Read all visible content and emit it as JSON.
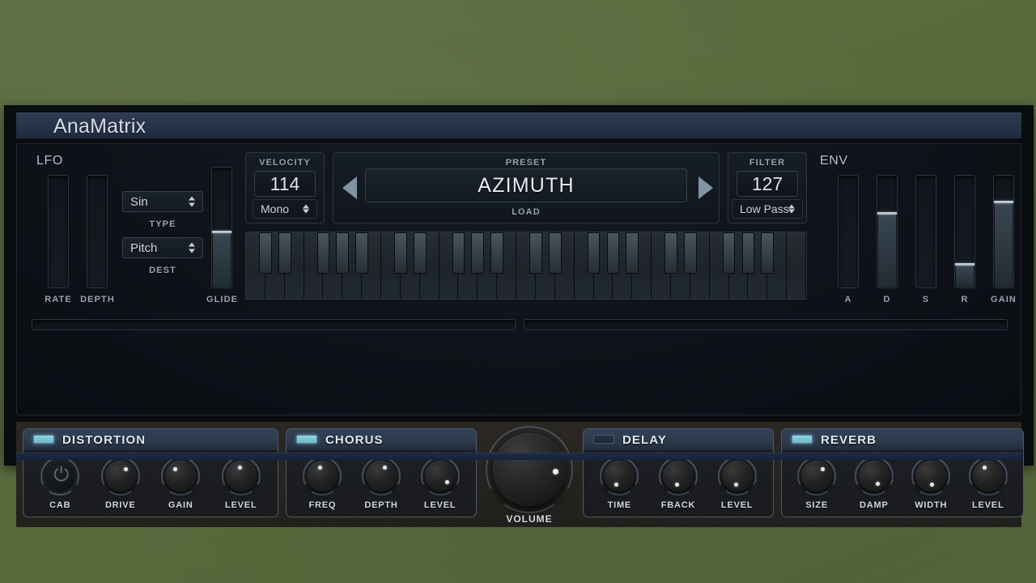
{
  "app": {
    "title": "AnaMatrix"
  },
  "lfo": {
    "section_label": "LFO",
    "rate_label": "RATE",
    "depth_label": "DEPTH",
    "rate_value": 0,
    "depth_value": 0,
    "type_label": "TYPE",
    "type_value": "Sin",
    "dest_label": "DEST",
    "dest_value": "Pitch"
  },
  "glide": {
    "label": "GLIDE",
    "value": 46
  },
  "velocity": {
    "label": "VELOCITY",
    "value": "114",
    "mode": "Mono"
  },
  "preset": {
    "label": "PRESET",
    "name": "AZIMUTH",
    "load_label": "LOAD",
    "prev_icon": "triangle-left-icon",
    "next_icon": "triangle-right-icon"
  },
  "filter": {
    "label": "FILTER",
    "value": "127",
    "type": "Low Pass"
  },
  "env": {
    "section_label": "ENV",
    "sliders": [
      {
        "label": "A",
        "value": 0
      },
      {
        "label": "D",
        "value": 65
      },
      {
        "label": "S",
        "value": 0
      },
      {
        "label": "R",
        "value": 20
      },
      {
        "label": "GAIN",
        "value": 75
      }
    ]
  },
  "keyboard": {
    "white_key_count": 29
  },
  "modbars": [
    {
      "name": "mod-bar-left",
      "value": 0
    },
    {
      "name": "mod-bar-right",
      "value": 0
    }
  ],
  "fx": [
    {
      "id": "distortion",
      "title": "DISTORTION",
      "enabled": true,
      "led_color": "#8cd7e6",
      "knobs": [
        {
          "label": "CAB",
          "icon": "power-icon",
          "angle": 0,
          "is_power": true
        },
        {
          "label": "DRIVE",
          "angle": 38
        },
        {
          "label": "GAIN",
          "angle": -40
        },
        {
          "label": "LEVEL",
          "angle": -8
        }
      ]
    },
    {
      "id": "chorus",
      "title": "CHORUS",
      "enabled": true,
      "led_color": "#8cd7e6",
      "knobs": [
        {
          "label": "FREQ",
          "angle": -16
        },
        {
          "label": "DEPTH",
          "angle": 22
        },
        {
          "label": "LEVEL",
          "angle": 130
        }
      ]
    },
    {
      "id": "delay",
      "title": "DELAY",
      "enabled": false,
      "led_color": "#27323f",
      "knobs": [
        {
          "label": "TIME",
          "angle": 200
        },
        {
          "label": "FBACK",
          "angle": 188
        },
        {
          "label": "LEVEL",
          "angle": 186
        }
      ]
    },
    {
      "id": "reverb",
      "title": "REVERB",
      "enabled": true,
      "led_color": "#8cd7e6",
      "knobs": [
        {
          "label": "SIZE",
          "angle": 40
        },
        {
          "label": "DAMP",
          "angle": 155
        },
        {
          "label": "WIDTH",
          "angle": 172
        },
        {
          "label": "LEVEL",
          "angle": -22
        }
      ]
    }
  ],
  "volume": {
    "label": "VOLUME",
    "angle": 95
  },
  "colors": {
    "background": "#5c6b3f",
    "panel": "#0f1319",
    "accent": "#8cd7e6",
    "title_bar": "#27344a",
    "text": "#d8dee6"
  }
}
